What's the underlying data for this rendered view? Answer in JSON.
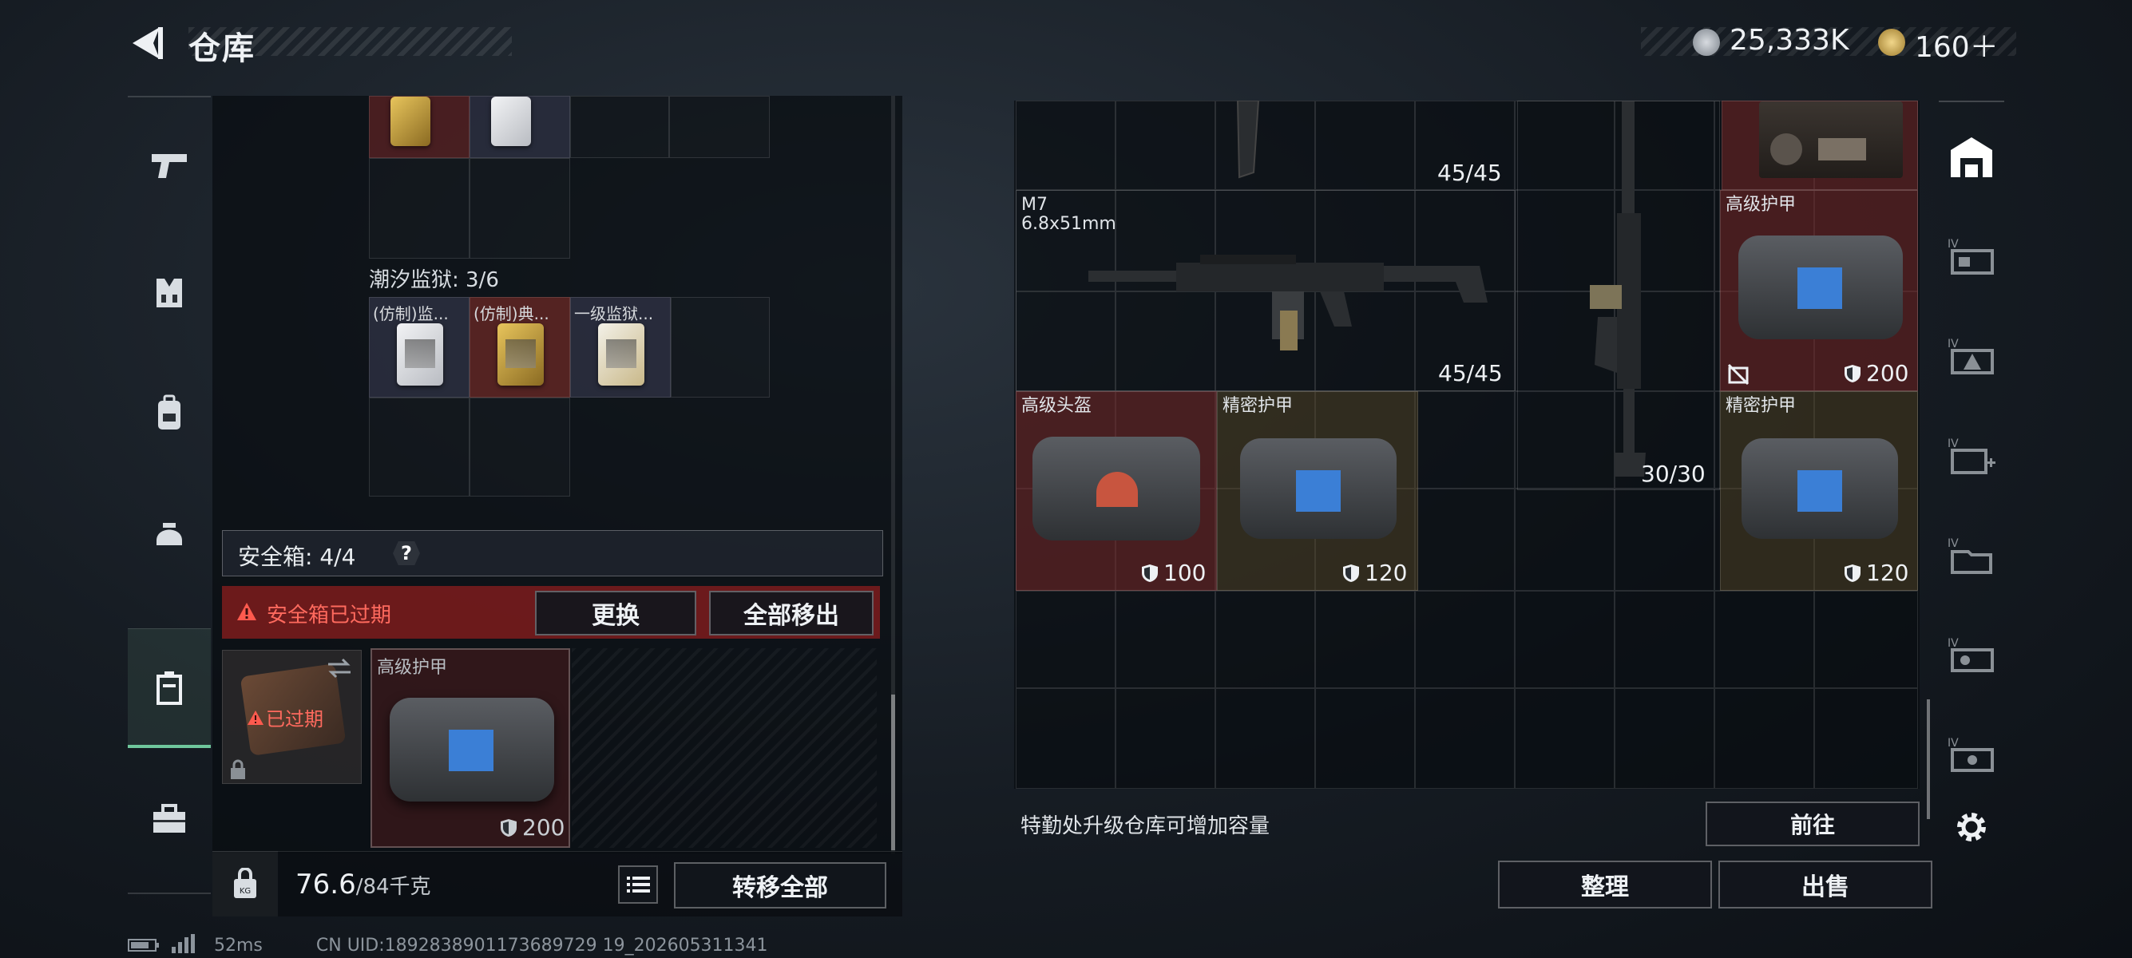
{
  "header": {
    "title": "仓库",
    "currency_silver": "25,333K",
    "currency_gold": "160＋"
  },
  "left_panel": {
    "tide_prison_label": "潮汐监狱: 3/6",
    "keycards": [
      {
        "label": "(仿制)监..."
      },
      {
        "label": "(仿制)典..."
      },
      {
        "label": "一级监狱..."
      }
    ],
    "safe_box": {
      "label": "安全箱: 4/4",
      "help": "?",
      "expired_warning": "安全箱已过期",
      "replace_button": "更换",
      "remove_all_button": "全部移出",
      "case_status": "已过期",
      "item_label": "高级护甲",
      "item_value": "200"
    },
    "weight_current": "76.6",
    "weight_max": "/84千克",
    "transfer_all_button": "转移全部"
  },
  "right_panel": {
    "top_ammo_1": "45/45",
    "weapon_name": "M7",
    "weapon_caliber": "6.8x51mm",
    "weapon_ammo": "45/45",
    "rifle_ammo": "30/30",
    "items": [
      {
        "label": "高级护甲",
        "value": "200"
      },
      {
        "label": "高级头盔",
        "value": "100"
      },
      {
        "label": "精密护甲",
        "value": "120"
      },
      {
        "label": "精密护甲",
        "value": "120"
      }
    ],
    "hint": "特勤处升级仓库可增加容量",
    "goto_button": "前往",
    "organize_button": "整理",
    "sell_button": "出售"
  },
  "status_bar": {
    "ping": "52ms",
    "uid": "CN UID:1892838901173689729 19_202605311341"
  },
  "colors": {
    "accent_green": "#6fc79c",
    "warning_red": "#ff6a5e",
    "panel_bg": "#0b1016"
  },
  "icons": {
    "left_nav": [
      "pistol-icon",
      "vest-icon",
      "backpack-icon",
      "helmet-icon",
      "safe-box-icon",
      "toolbox-icon"
    ],
    "right_nav": [
      "warehouse-icon",
      "storage-1-icon",
      "storage-2-icon",
      "storage-3-icon",
      "storage-4-icon",
      "storage-5-icon",
      "storage-6-icon",
      "settings-icon"
    ]
  }
}
